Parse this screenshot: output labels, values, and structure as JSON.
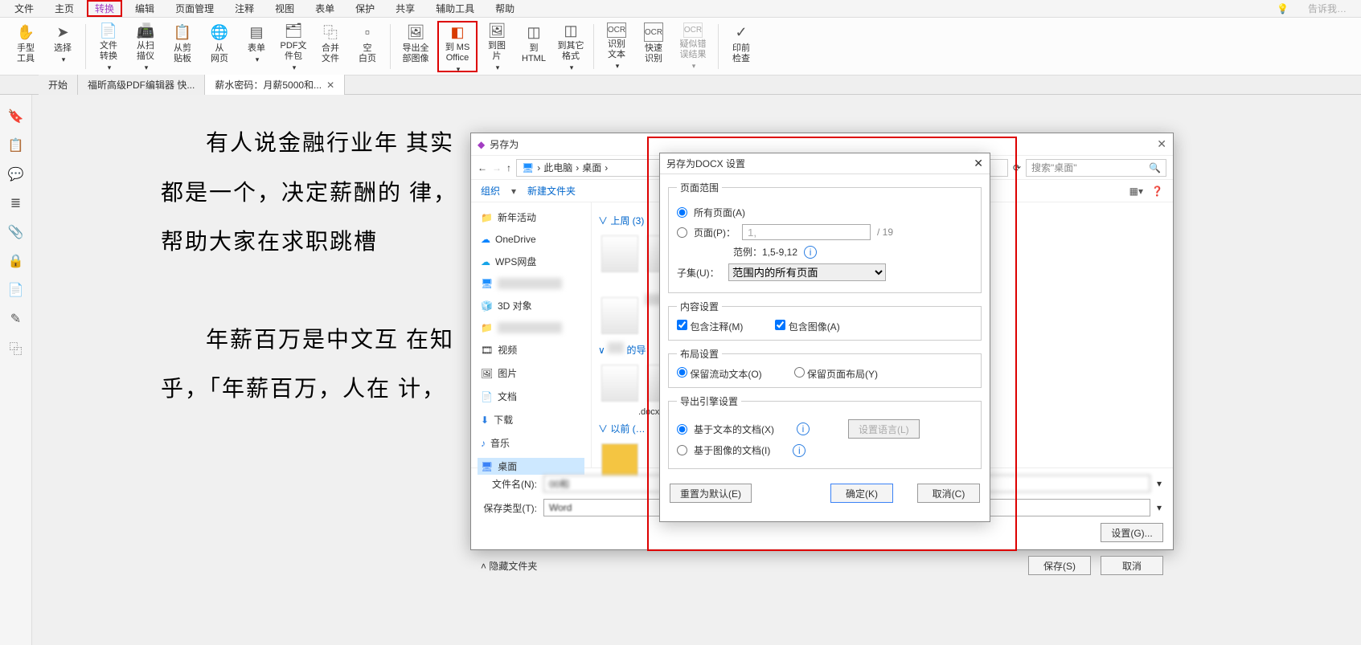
{
  "menu": {
    "items": [
      "文件",
      "主页",
      "转换",
      "编辑",
      "页面管理",
      "注释",
      "视图",
      "表单",
      "保护",
      "共享",
      "辅助工具",
      "帮助"
    ],
    "search_hint": "告诉我…"
  },
  "ribbon": {
    "items": [
      {
        "id": "hand-tool",
        "label": "手型\n工具"
      },
      {
        "id": "select",
        "label": "选择",
        "drop": true
      },
      {
        "id": "file-convert",
        "label": "文件\n转换",
        "drop": true
      },
      {
        "id": "from-scanner",
        "label": "从扫\n描仪",
        "drop": true
      },
      {
        "id": "from-clipboard",
        "label": "从剪\n贴板"
      },
      {
        "id": "from-webpage",
        "label": "从\n网页"
      },
      {
        "id": "form",
        "label": "表单",
        "drop": true
      },
      {
        "id": "pdf-package",
        "label": "PDF文\n件包",
        "drop": true
      },
      {
        "id": "merge-files",
        "label": "合并\n文件"
      },
      {
        "id": "blank-page",
        "label": "空\n白页"
      },
      {
        "id": "export-all-images",
        "label": "导出全\n部图像"
      },
      {
        "id": "to-ms-office",
        "label": "到 MS\nOffice",
        "drop": true,
        "hl": true
      },
      {
        "id": "to-image",
        "label": "到图\n片",
        "drop": true
      },
      {
        "id": "to-html",
        "label": "到\nHTML"
      },
      {
        "id": "to-other",
        "label": "到其它\n格式",
        "drop": true
      },
      {
        "id": "ocr-text",
        "label": "识别\n文本",
        "drop": true,
        "ocr": true
      },
      {
        "id": "quick-ocr",
        "label": "快速\n识别",
        "ocr": true
      },
      {
        "id": "ocr-suspect",
        "label": "疑似错\n误结果",
        "drop": true,
        "ocr": true,
        "disabled": true
      },
      {
        "id": "preflight",
        "label": "印前\n检查"
      }
    ]
  },
  "tabs": [
    {
      "label": "开始"
    },
    {
      "label": "福昕高级PDF编辑器 快..."
    },
    {
      "label": "薪水密码：月薪5000和...",
      "active": true,
      "closable": true
    }
  ],
  "sidebar_icons": [
    "bookmark-icon",
    "clipboard-icon",
    "comment-icon",
    "layers-icon",
    "attachment-icon",
    "lock-icon",
    "signature-icon",
    "pen-icon",
    "stamp-icon"
  ],
  "doc": {
    "p1": "有人说金融行业年                                                                                                其实",
    "p2": "都是一个，决定薪酬的                                                                                                        律，",
    "p3": "帮助大家在求职跳槽",
    "p4": "年薪百万是中文互                                                                                                            在知",
    "p5": "乎，「年薪百万，人在                                                                                                          计，"
  },
  "saveas": {
    "title": "另存为",
    "nav_back": "←",
    "nav_fwd": "→",
    "nav_up": "↑",
    "path_pc": "此电脑",
    "path_desktop": "桌面",
    "search_placeholder": "搜索\"桌面\"",
    "organize": "组织",
    "newfolder": "新建文件夹",
    "tree": [
      {
        "label": "新年活动",
        "type": "folder"
      },
      {
        "label": "OneDrive",
        "type": "cloud"
      },
      {
        "label": "WPS网盘",
        "type": "cloud-orange"
      },
      {
        "label": "(blurred)",
        "type": "pc",
        "blur": true
      },
      {
        "label": "3D 对象",
        "type": "3d"
      },
      {
        "label": "(blurred)",
        "type": "folder",
        "blur": true
      },
      {
        "label": "视频",
        "type": "video"
      },
      {
        "label": "图片",
        "type": "image"
      },
      {
        "label": "文档",
        "type": "doc"
      },
      {
        "label": "下载",
        "type": "download"
      },
      {
        "label": "音乐",
        "type": "music"
      },
      {
        "label": "桌面",
        "type": "desktop",
        "selected": true
      }
    ],
    "groups": [
      {
        "label": "∨ 上周 (3)"
      },
      {
        "label": "∨",
        "text_after": "的导"
      },
      {
        "label": ".docx"
      },
      {
        "label": "∨        以前 (…"
      }
    ],
    "filename_label": "文件名(N):",
    "filetype_label": "保存类型(T):",
    "filetype_value": "Word",
    "settings_btn": "设置(G)...",
    "hide_folders": "隐藏文件夹",
    "save_btn": "保存(S)",
    "cancel_btn": "取消"
  },
  "cfg": {
    "title": "另存为DOCX 设置",
    "page_range": "页面范围",
    "all_pages": "所有页面(A)",
    "page_label": "页面(P)：",
    "page_value": "1,",
    "total": "/   19",
    "example": "范例：1,5-9,12",
    "subset_label": "子集(U)：",
    "subset_value": "范围内的所有页面",
    "content": "内容设置",
    "inc_comments": "包含注释(M)",
    "inc_images": "包含图像(A)",
    "layout": "布局设置",
    "flow_text": "保留流动文本(O)",
    "page_layout": "保留页面布局(Y)",
    "engine": "导出引擎设置",
    "text_based": "基于文本的文档(X)",
    "image_based": "基于图像的文档(I)",
    "lang_btn": "设置语言(L)",
    "reset": "重置为默认(E)",
    "ok": "确定(K)",
    "cancel": "取消(C)"
  }
}
